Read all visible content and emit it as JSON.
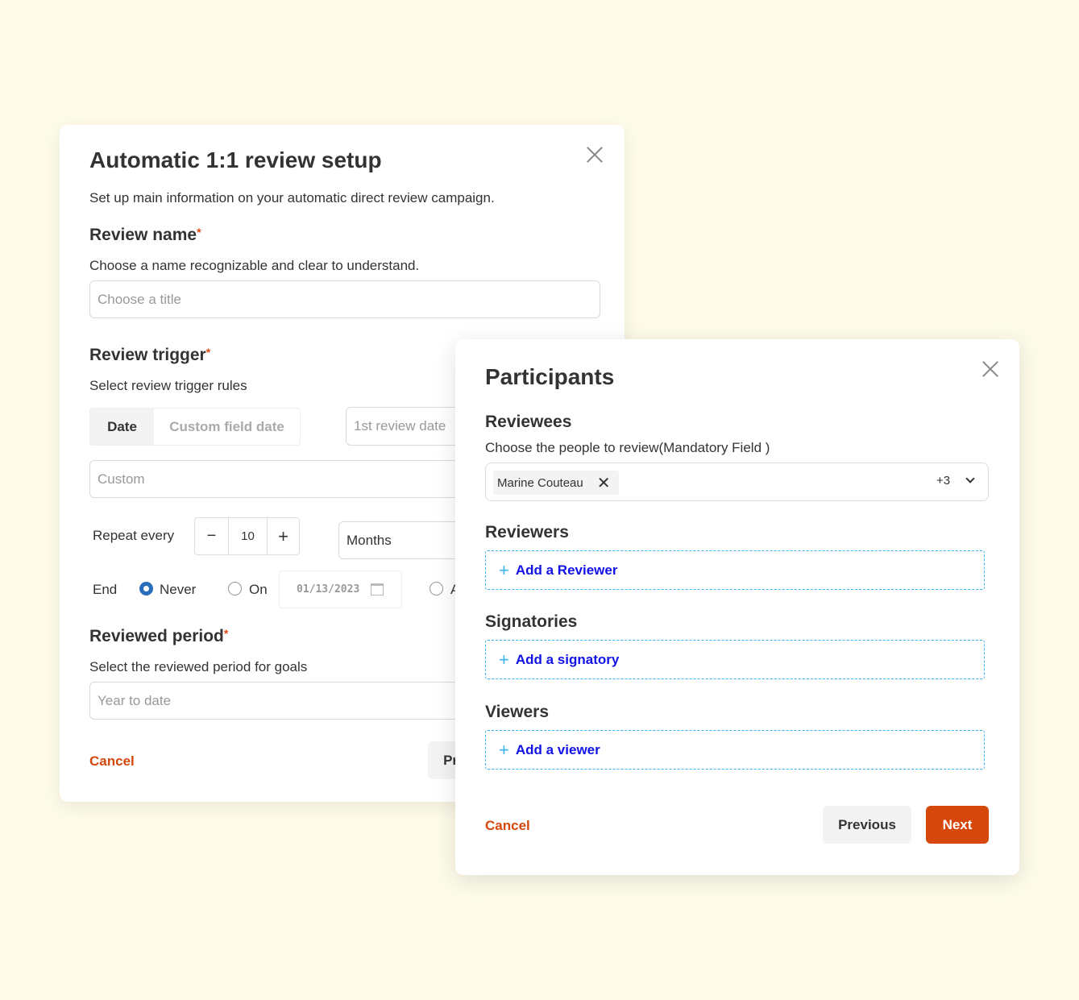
{
  "setup": {
    "title": "Automatic 1:1 review setup",
    "subtitle": "Set up main information on your automatic direct review campaign.",
    "review_name": {
      "label": "Review name",
      "required": "*",
      "help": "Choose a name recognizable and clear to understand.",
      "placeholder": "Choose a title"
    },
    "review_trigger": {
      "label": "Review trigger",
      "required": "*",
      "help": "Select review trigger rules",
      "tabs": [
        {
          "label": "Date",
          "active": true
        },
        {
          "label": "Custom field date",
          "active": false
        }
      ],
      "first_date_placeholder": "1st review date",
      "custom_placeholder": "Custom",
      "repeat_label": "Repeat every",
      "repeat_value": "10",
      "minus": "−",
      "plus": "+",
      "unit": "Months",
      "end_label": "End",
      "end_options": [
        {
          "label": "Never",
          "selected": true
        },
        {
          "label": "On",
          "selected": false
        },
        {
          "label": "A",
          "selected": false
        }
      ],
      "end_date": "01/13/2023"
    },
    "reviewed_period": {
      "label": "Reviewed period",
      "required": "*",
      "help": "Select the reviewed period for goals",
      "placeholder": "Year to date"
    },
    "cancel": "Cancel",
    "previous": "Previous"
  },
  "participants": {
    "title": "Participants",
    "reviewees": {
      "label": "Reviewees",
      "help": "Choose the people to review(Mandatory Field )",
      "chip": "Marine Couteau",
      "more": "+3"
    },
    "reviewers": {
      "label": "Reviewers",
      "add": "Add a Reviewer"
    },
    "signatories": {
      "label": "Signatories",
      "add": "Add a signatory"
    },
    "viewers": {
      "label": "Viewers",
      "add": "Add a viewer"
    },
    "cancel": "Cancel",
    "previous": "Previous",
    "next": "Next"
  },
  "colors": {
    "accent": "#d6470c",
    "link": "#1212e6",
    "dashed_border": "#3ab4f2",
    "radio": "#2a6ebb",
    "background": "#fefbea"
  }
}
